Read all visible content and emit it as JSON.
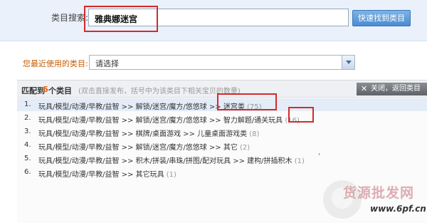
{
  "search": {
    "label": "类目搜索:",
    "value": "雅典娜迷宫",
    "button_label": "快速找到类目"
  },
  "recent": {
    "label": "您最近使用的类目:",
    "selected": "请选择"
  },
  "results": {
    "prefix": "匹配到",
    "count": "6",
    "suffix": "个类目",
    "hint": "(双击直接发布，括号中为该类目下相关宝贝的数量)",
    "close_label": "关闭，返回类目",
    "rows": [
      {
        "num": "1.",
        "path": "玩具/模型/动漫/早教/益智 >> 解锁/迷宫/魔方/悠悠球 >> 迷宫类",
        "count": "(75)"
      },
      {
        "num": "2.",
        "path": "玩具/模型/动漫/早教/益智 >> 解锁/迷宫/魔方/悠悠球 >> 智力解题/通关玩具",
        "count": "(16)"
      },
      {
        "num": "3.",
        "path": "玩具/模型/动漫/早教/益智 >> 棋牌/桌面游戏 >> 儿童桌面游戏类",
        "count": "(8)"
      },
      {
        "num": "4.",
        "path": "玩具/模型/动漫/早教/益智 >> 解锁/迷宫/魔方/悠悠球 >> 其它",
        "count": "(2)"
      },
      {
        "num": "5.",
        "path": "玩具/模型/动漫/早教/益智 >> 积木/拼装/串珠/拼图/配对玩具 >> 建构/拼插积木",
        "count": "(1)"
      },
      {
        "num": "6.",
        "path": "玩具/模型/动漫/早教/益智 >> 其它玩具",
        "count": "(1)"
      }
    ]
  },
  "watermark": {
    "text": "货源批发网",
    "url": "www.6pf.cn"
  },
  "colors": {
    "annotation_red": "#d42a2a",
    "count_orange": "#e05a00",
    "recent_label_orange": "#c75b00",
    "button_blue": "#4a8bd0"
  }
}
